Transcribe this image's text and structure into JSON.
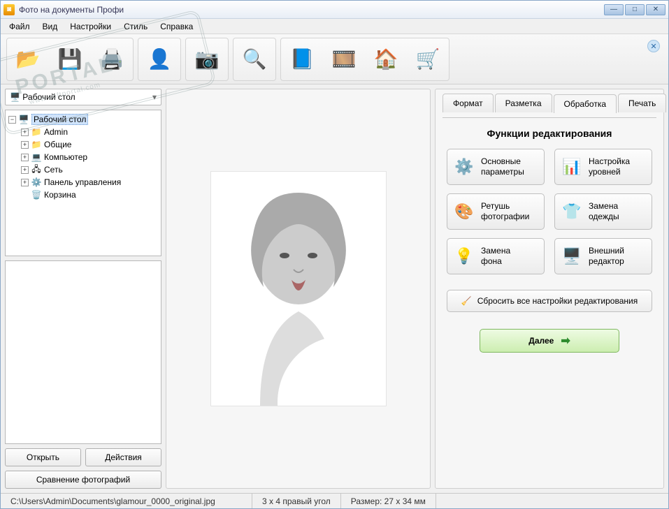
{
  "window": {
    "title": "Фото на документы Профи"
  },
  "menubar": [
    "Файл",
    "Вид",
    "Настройки",
    "Стиль",
    "Справка"
  ],
  "sidebar": {
    "path_combo": "Рабочий стол",
    "root": {
      "label": "Рабочий стол",
      "expanded": true,
      "selected": true
    },
    "children": [
      {
        "label": "Admin",
        "icon": "folder-user",
        "expandable": true
      },
      {
        "label": "Общие",
        "icon": "folder",
        "expandable": true
      },
      {
        "label": "Компьютер",
        "icon": "computer",
        "expandable": true
      },
      {
        "label": "Сеть",
        "icon": "network",
        "expandable": true
      },
      {
        "label": "Панель управления",
        "icon": "control-panel",
        "expandable": true
      },
      {
        "label": "Корзина",
        "icon": "recycle-bin",
        "expandable": false
      }
    ],
    "buttons": {
      "open": "Открыть",
      "actions": "Действия",
      "compare": "Сравнение фотографий"
    }
  },
  "tabs": [
    "Формат",
    "Разметка",
    "Обработка",
    "Печать"
  ],
  "active_tab": 2,
  "edit_section": {
    "title": "Функции редактирования",
    "buttons": [
      {
        "label": "Основные\nпараметры",
        "icon": "gear"
      },
      {
        "label": "Настройка\nуровней",
        "icon": "levels"
      },
      {
        "label": "Ретушь\nфотографии",
        "icon": "palette"
      },
      {
        "label": "Замена\nодежды",
        "icon": "clothes"
      },
      {
        "label": "Замена\nфона",
        "icon": "lamp"
      },
      {
        "label": "Внешний\nредактор",
        "icon": "external"
      }
    ],
    "reset": "Сбросить все настройки редактирования",
    "next": "Далее"
  },
  "statusbar": {
    "path": "C:\\Users\\Admin\\Documents\\glamour_0000_original.jpg",
    "corner": "3 x 4 правый угол",
    "size": "Размер: 27 x 34 мм"
  },
  "watermark": {
    "main": "PORTAL",
    "sub": "www.softportal.com"
  }
}
